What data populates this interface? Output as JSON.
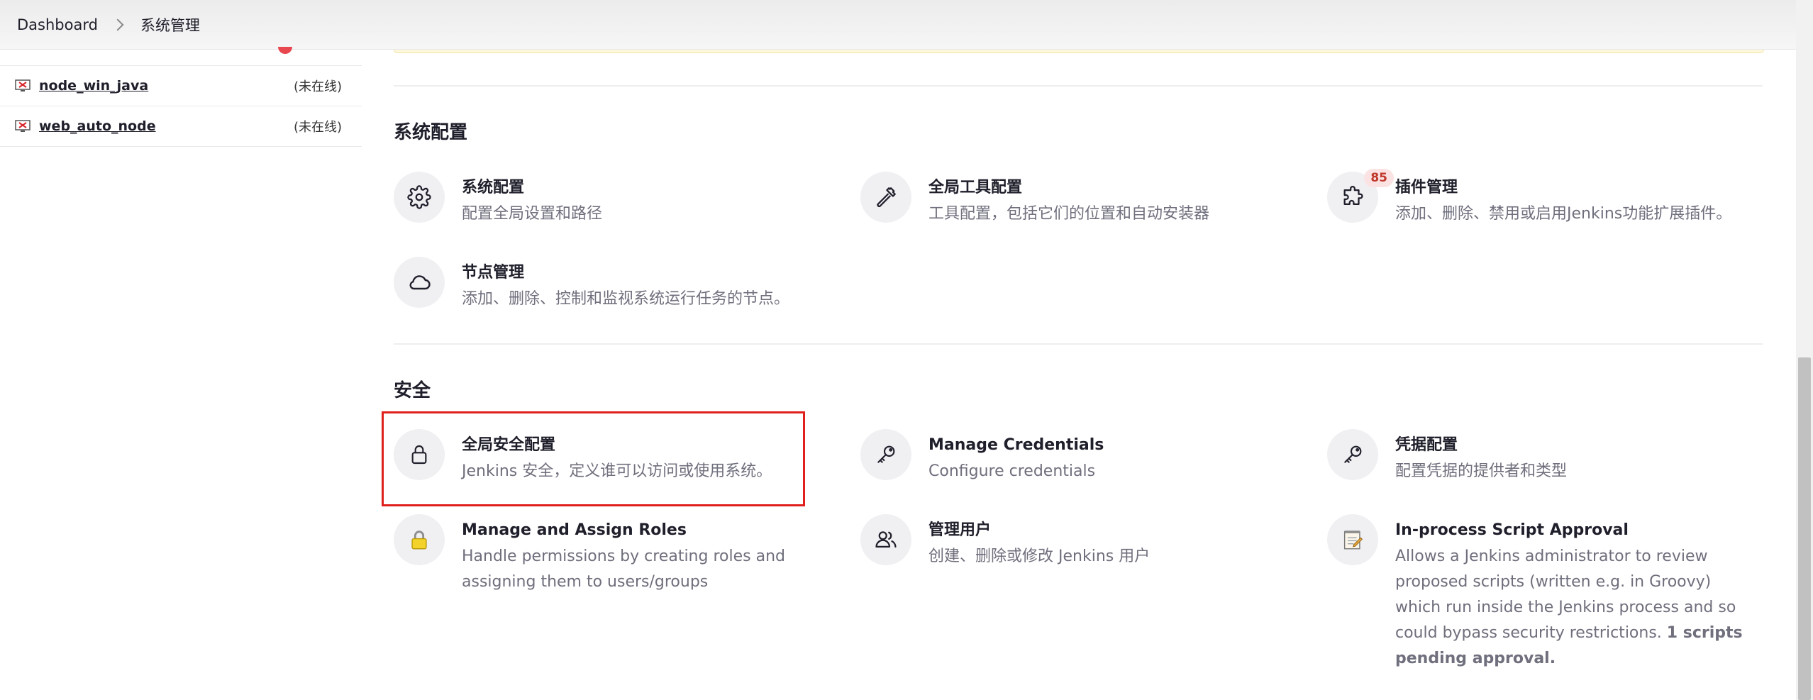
{
  "breadcrumb": {
    "home": "Dashboard",
    "current": "系统管理"
  },
  "sidebar": {
    "nodes": [
      {
        "name": "node_win_java",
        "status": "(未在线)",
        "icon": "offline-computer-icon"
      },
      {
        "name": "web_auto_node",
        "status": "(未在线)",
        "icon": "offline-computer-icon"
      }
    ]
  },
  "sections": {
    "system": {
      "title": "系统配置",
      "items": [
        {
          "title": "系统配置",
          "desc": "配置全局设置和路径",
          "icon": "gear-icon"
        },
        {
          "title": "全局工具配置",
          "desc": "工具配置，包括它们的位置和自动安装器",
          "icon": "hammer-icon"
        },
        {
          "title": "插件管理",
          "desc": "添加、删除、禁用或启用Jenkins功能扩展插件。",
          "icon": "puzzle-icon",
          "badge": "85"
        },
        {
          "title": "节点管理",
          "desc": "添加、删除、控制和监视系统运行任务的节点。",
          "icon": "cloud-icon"
        }
      ]
    },
    "security": {
      "title": "安全",
      "items": [
        {
          "title": "全局安全配置",
          "desc": "Jenkins 安全，定义谁可以访问或使用系统。",
          "icon": "lock-icon"
        },
        {
          "title": "Manage Credentials",
          "desc": "Configure credentials",
          "icon": "key-icon"
        },
        {
          "title": "凭据配置",
          "desc": "配置凭据的提供者和类型",
          "icon": "key-icon"
        },
        {
          "title": "Manage and Assign Roles",
          "desc": "Handle permissions by creating roles and assigning them to users/groups",
          "icon": "yellow-lock-icon"
        },
        {
          "title": "管理用户",
          "desc": "创建、删除或修改 Jenkins 用户",
          "icon": "users-icon"
        },
        {
          "title": "In-process Script Approval",
          "desc": "Allows a Jenkins administrator to review proposed scripts (written e.g. in Groovy) which run inside the Jenkins process and so could bypass security restrictions.",
          "desc_bold": "1 scripts pending approval.",
          "icon": "notepad-icon"
        }
      ]
    }
  },
  "colors": {
    "highlight": "#e0201d",
    "badge_text": "#c0392b",
    "muted_text": "#6f6f7d"
  }
}
